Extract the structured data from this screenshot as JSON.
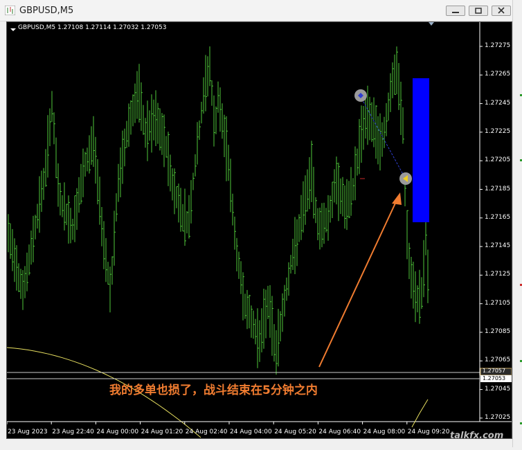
{
  "window": {
    "title": "GBPUSD,M5"
  },
  "chart": {
    "header": "GBPUSD,M5  1.27108 1.27114 1.27032 1.27053",
    "annotation": "我的多单也损了，战斗结束在5分钟之内",
    "price_labels": [
      "1.27275",
      "1.27265",
      "1.27245",
      "1.27225",
      "1.27205",
      "1.27185",
      "1.27165",
      "1.27145",
      "1.27125",
      "1.27105",
      "1.27085",
      "1.27065",
      "1.27045",
      "1.27025"
    ],
    "price_tags": {
      "level1": "1.27057",
      "level2": "1.27053"
    },
    "time_labels": [
      "23 Aug 2023",
      "23 Aug 22:40",
      "24 Aug 00:00",
      "24 Aug 01:20",
      "24 Aug 02:40",
      "24 Aug 04:00",
      "24 Aug 05:20",
      "24 Aug 06:40",
      "24 Aug 08:00",
      "24 Aug 09:20"
    ],
    "watermark": "talkfx.com",
    "colors": {
      "bars": "#4fc83a",
      "ma": "#e8e060",
      "box": "#0000ff",
      "arrow": "#f07c30",
      "annotation": "#f07c30"
    }
  }
}
